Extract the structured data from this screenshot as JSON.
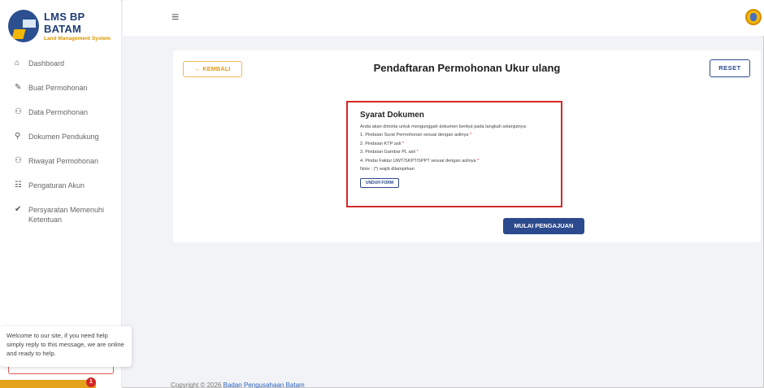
{
  "brand": {
    "title": "LMS BP BATAM",
    "subtitle": "Land Management System"
  },
  "sidebar": {
    "items": [
      {
        "label": "Dashboard",
        "icon": "home-icon"
      },
      {
        "label": "Buat Permohonan",
        "icon": "file-icon"
      },
      {
        "label": "Data Permohonan",
        "icon": "users-icon"
      },
      {
        "label": "Dokumen Pendukung",
        "icon": "paperclip-icon"
      },
      {
        "label": "Riwayat Permohonan",
        "icon": "users-icon"
      },
      {
        "label": "Pengaturan Akun",
        "icon": "account-icon"
      },
      {
        "label": "Persyaratan Memenuhi Ketentuan",
        "icon": "check-circle-icon"
      }
    ]
  },
  "chat": {
    "message": "Welcome to our site, if you need help simply reply to this message, we are online and ready to help.",
    "badge": "1"
  },
  "card": {
    "back_label": "← KEMBALI",
    "title": "Pendaftaran Permohonan Ukur ulang",
    "reset_label": "RESET",
    "start_label": "MULAI PENGAJUAN"
  },
  "requirements": {
    "title": "Syarat Dokumen",
    "intro": "Anda akan diminta untuk mengunggah dokumen berikut pada langkah selanjutnya:",
    "items": [
      "1. Pindaian Surat Permohonan sesuai dengan aslinya",
      "2. Pindaian KTP asli",
      "3. Pindaian Gambar PL asli",
      "4. Pindai Faktur UWT/SKPT/SPPT sesuai dengan aslinya"
    ],
    "required_mark": "*",
    "note": "Note : (*) wajib dilampirkan",
    "download_label": "UNDUH FORM"
  },
  "footer": {
    "copyright": "Copyright © 2026",
    "link": "Badan Pengusahaan Batam"
  },
  "colors": {
    "primary": "#2c4a8e",
    "accent": "#e59a18",
    "danger": "#d62828"
  }
}
